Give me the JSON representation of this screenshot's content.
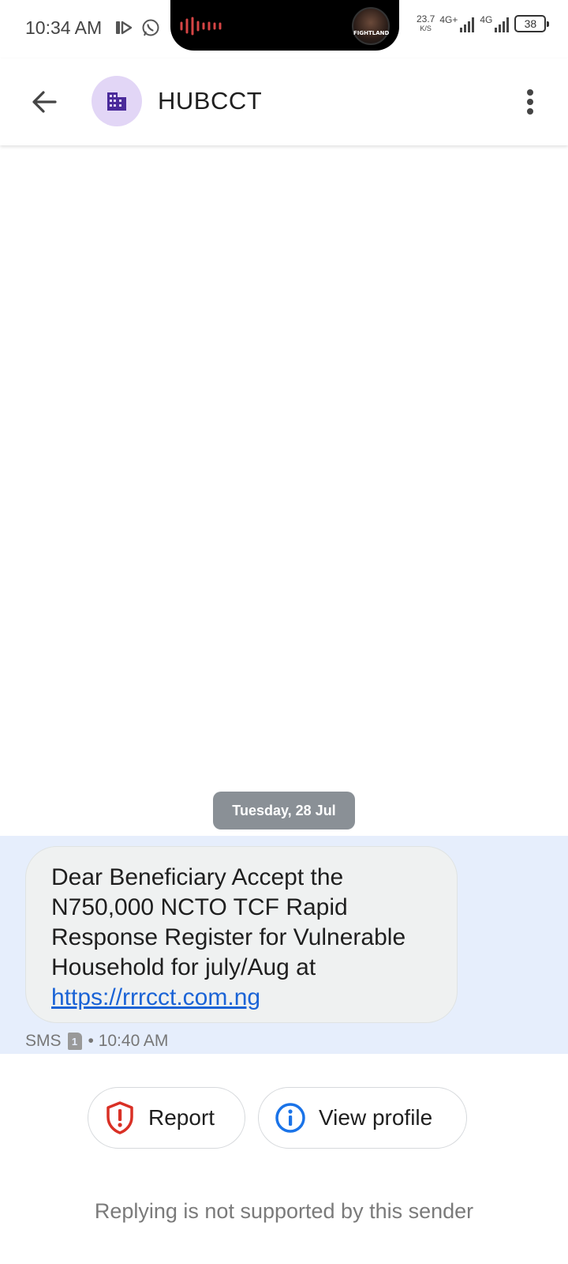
{
  "status_bar": {
    "time": "10:34 AM",
    "notch_label": "FIGHTLAND",
    "net_speed_value": "23.7",
    "net_speed_unit": "K/S",
    "signal_1": "4G+",
    "signal_2": "4G",
    "battery": "38"
  },
  "header": {
    "title": "HUBCCT",
    "avatar_icon": "building-icon",
    "avatar_color": "#e2d6f6"
  },
  "conversation": {
    "date_chip": "Tuesday, 28 Jul",
    "message": {
      "lines": [
        "Dear Beneficiary Accept the",
        "N750,000 NCTO TCF Rapid",
        "Response Register for Vulnerable",
        "Household for july/Aug at"
      ],
      "link": "https://rrrcct.com.ng",
      "type": "SMS",
      "sim": "1",
      "time": "• 10:40 AM"
    },
    "highlight_color": "#e6eefc",
    "bubble_color": "#eff1f1"
  },
  "actions": {
    "report_label": "Report",
    "view_profile_label": "View profile"
  },
  "footer": {
    "note": "Replying is not supported by this sender"
  },
  "colors": {
    "report_red": "#d93025",
    "info_blue": "#1a73e8",
    "link_blue": "#1a63d6"
  }
}
